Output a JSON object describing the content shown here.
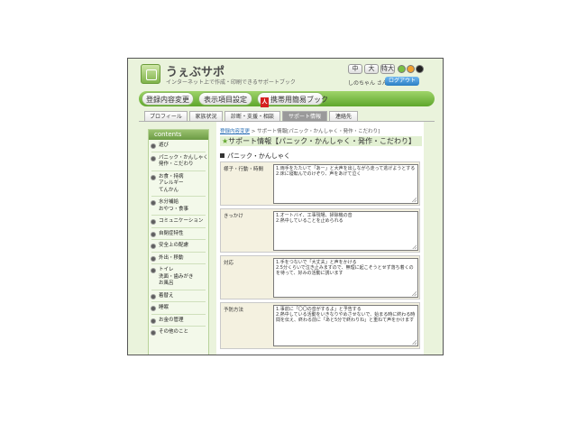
{
  "header": {
    "app_title": "うぇぶサポ",
    "app_subtitle": "インターネット上で作成・印刷できるサポートブック",
    "font_sizes": [
      "中",
      "大",
      "特大"
    ],
    "theme_colors": [
      "#79c043",
      "#f0a030",
      "#222222"
    ],
    "user_name": "しのちゃん さん",
    "logout_label": "ログアウト"
  },
  "menu": {
    "items": [
      "登録内容変更",
      "表示項目設定",
      "携帯用簡易ブック"
    ],
    "pdf_icon_text": "人"
  },
  "tabs": [
    "プロフィール",
    "家族状況",
    "診断・支援・相談",
    "サポート情報",
    "連絡先"
  ],
  "sidebar": {
    "header": "contents",
    "groups": [
      {
        "label": "遊び",
        "subs": []
      },
      {
        "label": "パニック・かんしゃく",
        "subs": [
          "発作・こだわり"
        ]
      },
      {
        "label": "お食・持病",
        "subs": [
          "アレルギー",
          "てんかん"
        ]
      },
      {
        "label": "水分補給",
        "subs": [
          "おやつ・食事"
        ]
      },
      {
        "label": "コミュニケーション",
        "subs": []
      },
      {
        "label": "自閉症特性",
        "subs": []
      },
      {
        "label": "安全上の配慮",
        "subs": []
      },
      {
        "label": "外出・移動",
        "subs": []
      },
      {
        "label": "トイレ",
        "subs": [
          "洗面・歯みがき",
          "お風呂"
        ]
      },
      {
        "label": "着替え",
        "subs": []
      },
      {
        "label": "睡眠",
        "subs": []
      },
      {
        "label": "お金の管理",
        "subs": []
      },
      {
        "label": "その他のこと",
        "subs": []
      }
    ]
  },
  "main": {
    "breadcrumb_link": "登録内容変更",
    "breadcrumb_rest": " > サポート情報[パニック・かんしゃく・発作・こだわり]",
    "section_title": "サポート情報【パニック・かんしゃく・発作・こだわり】",
    "sub_title": "パニック・かんしゃく",
    "rows": [
      {
        "label": "様子・行動・時間",
        "lines": [
          "1.両手をたたいて「あー」と大声を出しながら走って逃げようとする",
          "2.床に寝転んでのけぞり、声をあげて泣く"
        ]
      },
      {
        "label": "きっかけ",
        "lines": [
          "1.オートバイ、工事現場、掃除機の音",
          "2.熱中していることを止められる"
        ]
      },
      {
        "label": "対応",
        "lines": [
          "1.手をつないで「大丈夫」と声をかける",
          "2.5分くらいで泣き止みますので、無理に起こそうとせず落ち着くのを待って、好みの活動に誘います"
        ]
      },
      {
        "label": "予防方法",
        "lines": [
          "1.事前に「〇〇の音がするよ」と予告する",
          "2.熱中している活動をいきなりやめさせないで、始まる時に終わる時間を伝え、終わる前に「あと5分で終わりね」と重ねて声をかけます"
        ]
      }
    ]
  }
}
